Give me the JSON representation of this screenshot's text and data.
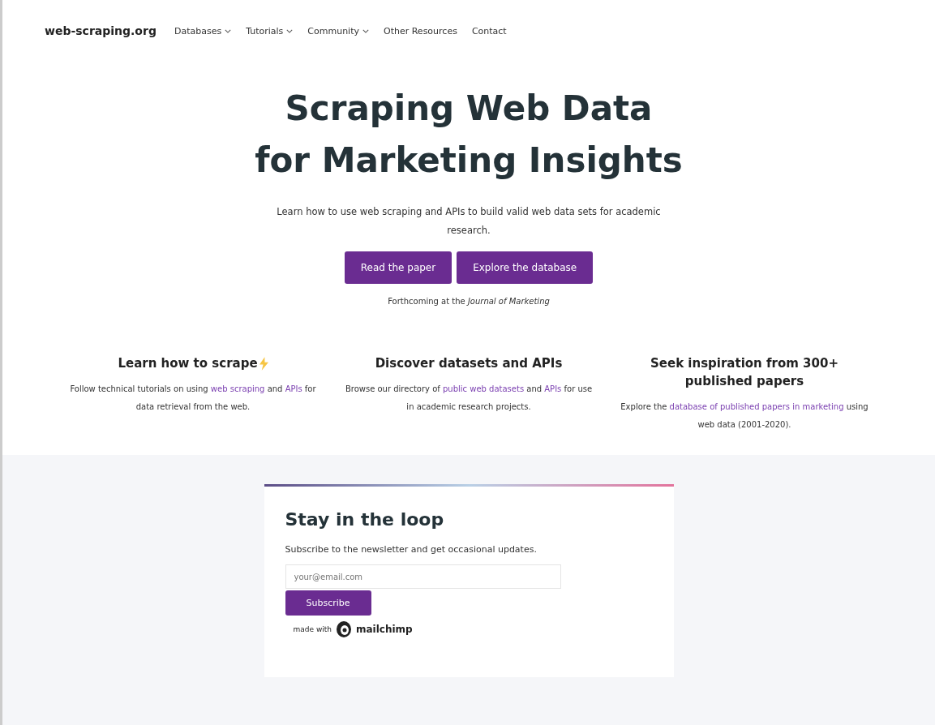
{
  "nav": {
    "brand": "web-scraping.org",
    "items": [
      {
        "label": "Databases",
        "dropdown": true
      },
      {
        "label": "Tutorials",
        "dropdown": true
      },
      {
        "label": "Community",
        "dropdown": true
      },
      {
        "label": "Other Resources",
        "dropdown": false
      },
      {
        "label": "Contact",
        "dropdown": false
      }
    ]
  },
  "hero": {
    "title_lines": [
      "Scraping Web Data",
      "for Marketing Insights"
    ],
    "subtitle": "Learn how to use web scraping and APIs to build valid web data sets for academic research.",
    "buttons": [
      "Read the paper",
      "Explore the database"
    ],
    "note": "Forthcoming at the *Journal of Marketing*"
  },
  "features": [
    {
      "title": "Learn how to scrape",
      "bolt": true,
      "text": [
        {
          "t": "Follow technical tutorials on using ",
          "link": false
        },
        {
          "t": "web scraping",
          "link": true
        },
        {
          "t": " and ",
          "link": false
        },
        {
          "t": "APIs",
          "link": true
        },
        {
          "t": " for data retrieval from the web.",
          "link": false
        }
      ]
    },
    {
      "title": "Discover datasets and APIs",
      "bolt": false,
      "text": [
        {
          "t": "Browse our directory of ",
          "link": false
        },
        {
          "t": "public web datasets",
          "link": true
        },
        {
          "t": " and ",
          "link": false
        },
        {
          "t": "APIs",
          "link": true
        },
        {
          "t": " for use in academic research projects.",
          "link": false
        }
      ]
    },
    {
      "title": "Seek inspiration from 300+ published papers",
      "bolt": false,
      "text": [
        {
          "t": "Explore the ",
          "link": false
        },
        {
          "t": "database of published papers in marketing",
          "link": true
        },
        {
          "t": " using web data (2001-2020).",
          "link": false
        }
      ]
    }
  ],
  "newsletter": {
    "title": "Stay in the loop",
    "text": "Subscribe to the newsletter and get occasional updates.",
    "email_placeholder": "your@email.com",
    "button": "Subscribe",
    "made_with": "made with",
    "brand": "mailchimp"
  }
}
